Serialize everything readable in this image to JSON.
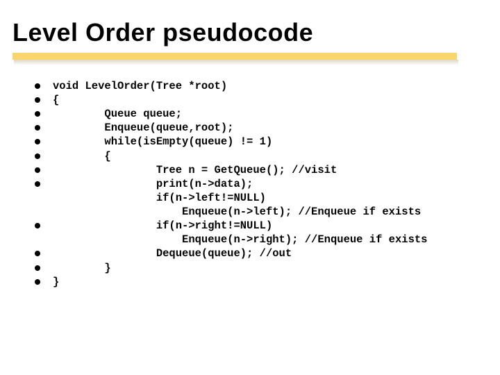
{
  "title": "Level Order pseudocode",
  "code": {
    "lines": [
      {
        "bullet": true,
        "text": "void LevelOrder(Tree *root)"
      },
      {
        "bullet": true,
        "text": "{"
      },
      {
        "bullet": true,
        "text": "        Queue queue;"
      },
      {
        "bullet": true,
        "text": "        Enqueue(queue,root);"
      },
      {
        "bullet": true,
        "text": "        while(isEmpty(queue) != 1)"
      },
      {
        "bullet": true,
        "text": "        {"
      },
      {
        "bullet": true,
        "text": "                Tree n = GetQueue(); //visit"
      },
      {
        "bullet": true,
        "text": "                print(n->data);"
      },
      {
        "bullet": false,
        "text": "                if(n->left!=NULL)"
      },
      {
        "bullet": false,
        "text": "                    Enqueue(n->left); //Enqueue if exists"
      },
      {
        "bullet": true,
        "text": "                if(n->right!=NULL)"
      },
      {
        "bullet": false,
        "text": "                    Enqueue(n->right); //Enqueue if exists"
      },
      {
        "bullet": true,
        "text": "                Dequeue(queue); //out"
      },
      {
        "bullet": true,
        "text": "        }"
      },
      {
        "bullet": true,
        "text": "}"
      }
    ]
  }
}
